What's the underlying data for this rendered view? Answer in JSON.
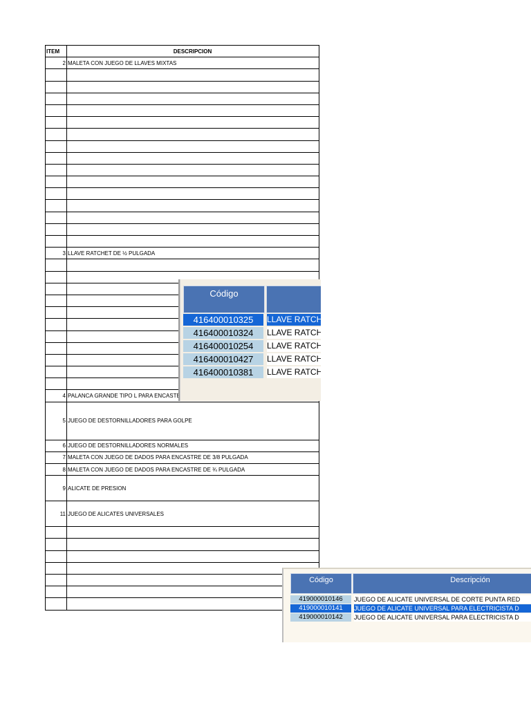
{
  "table": {
    "headers": {
      "item": "ITEM",
      "description": "DESCRIPCION"
    },
    "rows": [
      {
        "item": "2",
        "desc": "MALETA CON JUEGO DE LLAVES MIXTAS",
        "h": "n"
      },
      {
        "item": "",
        "desc": "",
        "h": "n"
      },
      {
        "item": "",
        "desc": "",
        "h": "n"
      },
      {
        "item": "",
        "desc": "",
        "h": "n"
      },
      {
        "item": "",
        "desc": "",
        "h": "n"
      },
      {
        "item": "",
        "desc": "",
        "h": "n"
      },
      {
        "item": "",
        "desc": "",
        "h": "n"
      },
      {
        "item": "",
        "desc": "",
        "h": "n"
      },
      {
        "item": "",
        "desc": "",
        "h": "n"
      },
      {
        "item": "",
        "desc": "",
        "h": "n"
      },
      {
        "item": "",
        "desc": "",
        "h": "n"
      },
      {
        "item": "",
        "desc": "",
        "h": "n"
      },
      {
        "item": "",
        "desc": "",
        "h": "n"
      },
      {
        "item": "",
        "desc": "",
        "h": "n"
      },
      {
        "item": "",
        "desc": "",
        "h": "n"
      },
      {
        "item": "",
        "desc": "",
        "h": "n"
      },
      {
        "item": "3",
        "desc": "LLAVE RATCHET DE ½ PULGADA",
        "h": "n"
      },
      {
        "item": "",
        "desc": "",
        "h": "n"
      },
      {
        "item": "",
        "desc": "",
        "h": "n"
      },
      {
        "item": "",
        "desc": "",
        "h": "n"
      },
      {
        "item": "",
        "desc": "",
        "h": "n"
      },
      {
        "item": "",
        "desc": "",
        "h": "n"
      },
      {
        "item": "",
        "desc": "",
        "h": "n"
      },
      {
        "item": "",
        "desc": "",
        "h": "n"
      },
      {
        "item": "",
        "desc": "",
        "h": "n"
      },
      {
        "item": "",
        "desc": "",
        "h": "n"
      },
      {
        "item": "",
        "desc": "",
        "h": "n"
      },
      {
        "item": "",
        "desc": "",
        "h": "n"
      },
      {
        "item": "4",
        "desc": "PALANCA GRANDE TIPO L PARA ENCASTE ½ PULGADA",
        "h": "n"
      },
      {
        "item": "5",
        "desc": "JUEGO DE DESTORNILLADORES PARA GOLPE",
        "h": "tall"
      },
      {
        "item": "6",
        "desc": "JUEGO DE DESTORNILLADORES NORMALES",
        "h": "n"
      },
      {
        "item": "7",
        "desc": "MALETA CON JUEGO DE DADOS PARA ENCASTRE DE 3/8 PULGADA",
        "h": "n"
      },
      {
        "item": "8",
        "desc": "MALETA CON JUEGO DE DADOS PARA ENCASTRE DE ¾ PULGADA",
        "h": "n"
      },
      {
        "item": "9",
        "desc": "ALICATE DE PRESION",
        "h": "mid"
      },
      {
        "item": "11",
        "desc": "JUEGO DE ALICATES UNIVERSALES",
        "h": "mid"
      },
      {
        "item": "",
        "desc": "",
        "h": "n"
      },
      {
        "item": "",
        "desc": "",
        "h": "n"
      },
      {
        "item": "",
        "desc": "",
        "h": "n"
      },
      {
        "item": "",
        "desc": "",
        "h": "n"
      },
      {
        "item": "",
        "desc": "",
        "h": "n"
      },
      {
        "item": "",
        "desc": "",
        "h": "n"
      },
      {
        "item": "",
        "desc": "",
        "h": "n"
      }
    ]
  },
  "screenshot1": {
    "header_code": "Código",
    "rows": [
      {
        "code": "416400010325",
        "desc": "LLAVE RATCH",
        "selected": true
      },
      {
        "code": "416400010324",
        "desc": "LLAVE RATCH",
        "selected": false
      },
      {
        "code": "416400010254",
        "desc": "LLAVE RATCH",
        "selected": false
      },
      {
        "code": "416400010427",
        "desc": "LLAVE RATCH",
        "selected": false
      },
      {
        "code": "416400010381",
        "desc": "LLAVE RATCH",
        "selected": false
      }
    ]
  },
  "screenshot2": {
    "header_code": "Código",
    "header_desc": "Descripción",
    "rows": [
      {
        "code": "419000010146",
        "desc": "JUEGO DE ALICATE UNIVERSAL DE CORTE PUNTA RED",
        "selected": false
      },
      {
        "code": "419000010141",
        "desc": "JUEGO DE ALICATE UNIVERSAL PARA ELECTRICISTA D",
        "selected": true
      },
      {
        "code": "419000010142",
        "desc": "JUEGO DE ALICATE UNIVERSAL PARA ELECTRICISTA D",
        "selected": false
      }
    ]
  },
  "colors": {
    "header_blue": "#4a73b3",
    "selected_blue": "#1566d6",
    "code_cell": "#b8d3e4"
  }
}
